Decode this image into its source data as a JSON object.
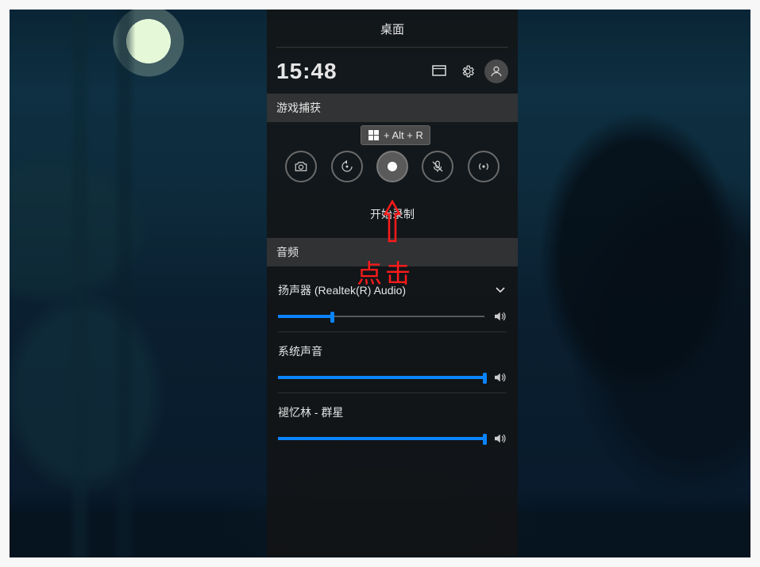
{
  "panel": {
    "title": "桌面",
    "time": "15:48"
  },
  "capture": {
    "header": "游戏捕获",
    "tooltip_shortcut": "+ Alt + R",
    "action_label": "开始录制"
  },
  "audio": {
    "header": "音频",
    "device": {
      "label": "扬声器 (Realtek(R) Audio)",
      "level_pct": 26
    },
    "channels": [
      {
        "label": "系统声音",
        "level_pct": 100
      },
      {
        "label": "褪忆林 - 群星",
        "level_pct": 100
      }
    ]
  },
  "annotation": {
    "text": "点击",
    "color": "#ff1a1a"
  }
}
